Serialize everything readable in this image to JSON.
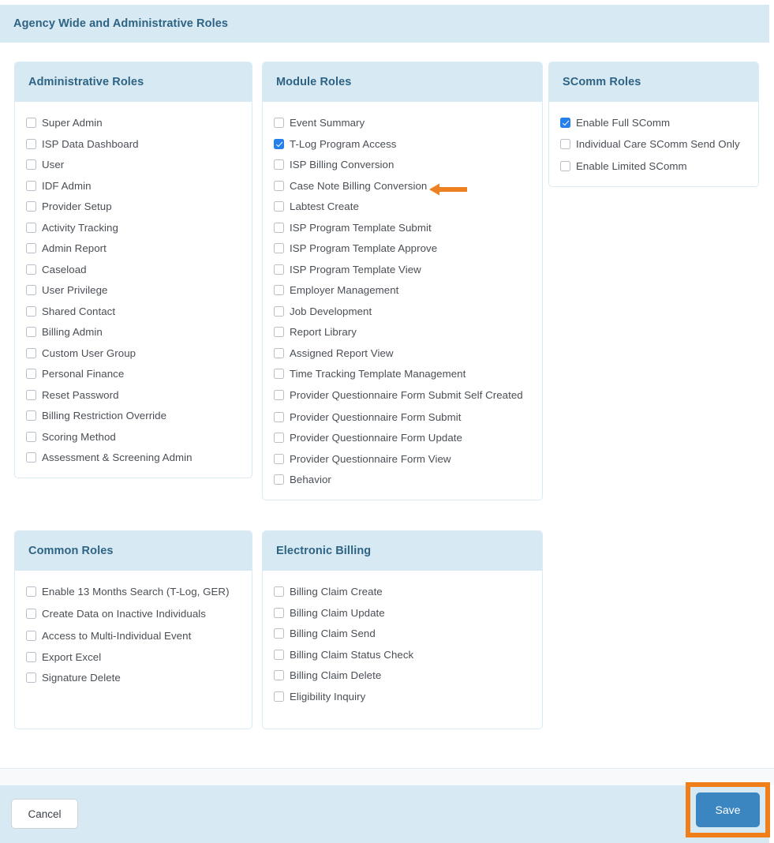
{
  "header": {
    "title": "Agency Wide and Administrative Roles"
  },
  "colors": {
    "header_band": "#d7eaf4",
    "header_text": "#2e6384",
    "checkbox_checked": "#2680eb",
    "arrow_annotation": "#ef8022",
    "save_highlight": "#f07f1a",
    "save_button": "#3b85c0",
    "label_text": "#4a4f55"
  },
  "panels": {
    "administrative_roles": {
      "title": "Administrative Roles",
      "items": [
        {
          "label": "Super Admin",
          "checked": false
        },
        {
          "label": "ISP Data Dashboard",
          "checked": false
        },
        {
          "label": "User",
          "checked": false
        },
        {
          "label": "IDF Admin",
          "checked": false
        },
        {
          "label": "Provider Setup",
          "checked": false
        },
        {
          "label": "Activity Tracking",
          "checked": false
        },
        {
          "label": "Admin Report",
          "checked": false
        },
        {
          "label": "Caseload",
          "checked": false
        },
        {
          "label": "User Privilege",
          "checked": false
        },
        {
          "label": "Shared Contact",
          "checked": false
        },
        {
          "label": "Billing Admin",
          "checked": false
        },
        {
          "label": "Custom User Group",
          "checked": false
        },
        {
          "label": "Personal Finance",
          "checked": false
        },
        {
          "label": "Reset Password",
          "checked": false
        },
        {
          "label": "Billing Restriction Override",
          "checked": false
        },
        {
          "label": "Scoring Method",
          "checked": false
        },
        {
          "label": "Assessment & Screening Admin",
          "checked": false
        }
      ]
    },
    "module_roles": {
      "title": "Module Roles",
      "items": [
        {
          "label": "Event Summary",
          "checked": false
        },
        {
          "label": "T-Log Program Access",
          "checked": true,
          "annotated": true
        },
        {
          "label": "ISP Billing Conversion",
          "checked": false
        },
        {
          "label": "Case Note Billing Conversion",
          "checked": false
        },
        {
          "label": "Labtest Create",
          "checked": false
        },
        {
          "label": "ISP Program Template Submit",
          "checked": false
        },
        {
          "label": "ISP Program Template Approve",
          "checked": false
        },
        {
          "label": "ISP Program Template View",
          "checked": false
        },
        {
          "label": "Employer Management",
          "checked": false
        },
        {
          "label": "Job Development",
          "checked": false
        },
        {
          "label": "Report Library",
          "checked": false
        },
        {
          "label": "Assigned Report View",
          "checked": false
        },
        {
          "label": "Time Tracking Template Management",
          "checked": false
        },
        {
          "label": "Provider Questionnaire Form Submit Self Created",
          "checked": false,
          "wraps": true
        },
        {
          "label": "Provider Questionnaire Form Submit",
          "checked": false
        },
        {
          "label": "Provider Questionnaire Form Update",
          "checked": false
        },
        {
          "label": "Provider Questionnaire Form View",
          "checked": false
        },
        {
          "label": "Behavior",
          "checked": false
        }
      ]
    },
    "scomm_roles": {
      "title": "SComm Roles",
      "items": [
        {
          "label": "Enable Full SComm",
          "checked": true
        },
        {
          "label": "Individual Care SComm Send Only",
          "checked": false,
          "wraps": true
        },
        {
          "label": "Enable Limited SComm",
          "checked": false
        }
      ]
    },
    "common_roles": {
      "title": "Common Roles",
      "items": [
        {
          "label": "Enable 13 Months Search (T-Log, GER)",
          "checked": false,
          "wraps": true
        },
        {
          "label": "Create Data on Inactive Individuals",
          "checked": false,
          "wraps": true
        },
        {
          "label": "Access to Multi-Individual Event",
          "checked": false
        },
        {
          "label": "Export Excel",
          "checked": false
        },
        {
          "label": "Signature Delete",
          "checked": false
        }
      ]
    },
    "electronic_billing": {
      "title": "Electronic Billing",
      "items": [
        {
          "label": "Billing Claim Create",
          "checked": false
        },
        {
          "label": "Billing Claim Update",
          "checked": false
        },
        {
          "label": "Billing Claim Send",
          "checked": false
        },
        {
          "label": "Billing Claim Status Check",
          "checked": false
        },
        {
          "label": "Billing Claim Delete",
          "checked": false
        },
        {
          "label": "Eligibility Inquiry",
          "checked": false
        }
      ]
    }
  },
  "footer": {
    "cancel_label": "Cancel",
    "save_label": "Save"
  }
}
